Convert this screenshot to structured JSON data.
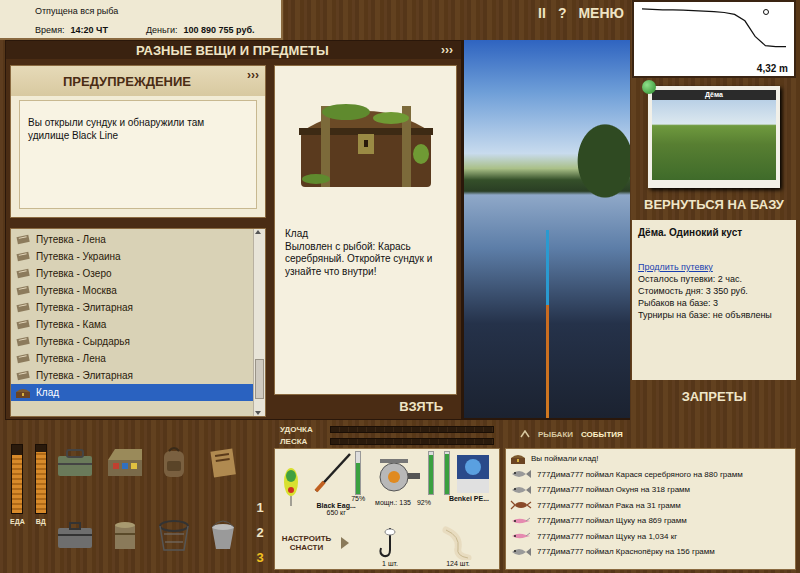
{
  "status": {
    "message": "Отпущена вся рыба",
    "time_label": "Время:",
    "time": "14:20 ЧТ",
    "money_label": "Деньги:",
    "money": "100 890 755 руб."
  },
  "top_controls": [
    "II",
    "?",
    "МЕНЮ"
  ],
  "depth_chart": {
    "depths": [
      0.2,
      0.25,
      0.3,
      0.3,
      0.35,
      0.4,
      0.45,
      0.5,
      0.6,
      0.8,
      1.5,
      3.2,
      4.2,
      4.32,
      4.32
    ],
    "reading": "4,32 m"
  },
  "window": {
    "title": "РАЗНЫЕ ВЕЩИ И ПРЕДМЕТЫ",
    "arrows": "›››"
  },
  "warning": {
    "title": "ПРЕДУПРЕЖДЕНИЕ",
    "arrows": "›››",
    "text": "Вы открыли сундук и обнаружили там удилище Black Line"
  },
  "items": [
    {
      "label": "Путевка - Лена",
      "selected": false,
      "kind": "permit"
    },
    {
      "label": "Путевка - Украина",
      "selected": false,
      "kind": "permit"
    },
    {
      "label": "Путевка - Озеро",
      "selected": false,
      "kind": "permit"
    },
    {
      "label": "Путевка - Москва",
      "selected": false,
      "kind": "permit"
    },
    {
      "label": "Путевка - Элитарная",
      "selected": false,
      "kind": "permit"
    },
    {
      "label": "Путевка - Кама",
      "selected": false,
      "kind": "permit"
    },
    {
      "label": "Путевка - Сырдарья",
      "selected": false,
      "kind": "permit"
    },
    {
      "label": "Путевка - Лена",
      "selected": false,
      "kind": "permit"
    },
    {
      "label": "Путевка - Элитарная",
      "selected": false,
      "kind": "permit"
    },
    {
      "label": "Клад",
      "selected": true,
      "kind": "treasure"
    }
  ],
  "list_scroll": {
    "level": 0.92
  },
  "detail": {
    "name": "Клад",
    "description": "Выловлен с рыбой: Карась серебряный. Откройте сундук и узнайте что внутри!"
  },
  "take_button": "ВЗЯТЬ",
  "location": {
    "card_label": "Дёма",
    "return_button": "ВЕРНУТЬСЯ НА БАЗУ",
    "name": "Дёма. Одинокий куст",
    "extend_link": "Продлить путевку",
    "details": [
      "Осталось путевки: 2 час.",
      "Стоимость дня: 3 350 руб.",
      "Рыбаков на базе: 3",
      "Турниры на базе: не объявлены"
    ],
    "bans_button": "ЗАПРЕТЫ"
  },
  "needs": [
    {
      "label": "ЕДА",
      "level": 0.85
    },
    {
      "label": "ВД",
      "level": 0.9
    }
  ],
  "tackle_sets": [
    {
      "label": "1",
      "selected": false
    },
    {
      "label": "2",
      "selected": false
    },
    {
      "label": "3",
      "selected": true
    }
  ],
  "tension": [
    {
      "label": "УДОЧКА",
      "level": 0
    },
    {
      "label": "ЛЕСКА",
      "level": 0
    }
  ],
  "event_tabs": [
    {
      "label": "РЫБАКИ",
      "selected": false
    },
    {
      "label": "СОБЫТИЯ",
      "selected": true
    }
  ],
  "tackle": {
    "rod": {
      "name": "Black Eag...",
      "load": "650 кг",
      "level": 0.75,
      "reading": "75%"
    },
    "reel": {
      "power": "мощн.: 135",
      "level": 0.92,
      "reading": "92%"
    },
    "line": {
      "name": "Benkei PE...",
      "level": 0.95
    },
    "hook": {
      "count": "1 шт."
    },
    "bait": {
      "count": "124 шт."
    },
    "setup_button": "НАСТРОИТЬ СНАСТИ"
  },
  "events": [
    {
      "text": "Вы поймали клад!",
      "kind": "treasure"
    },
    {
      "text": "777Дима777 поймал Карася серебряного на 880 грамм",
      "kind": "fish"
    },
    {
      "text": "777Дима777 поймал Окуня на 318 грамм",
      "kind": "fish"
    },
    {
      "text": "777Дима777 поймал Рака на 31 грамм",
      "kind": "crayfish"
    },
    {
      "text": "777Дима777 поймал Щуку на 869 грамм",
      "kind": "lure"
    },
    {
      "text": "777Дима777 поймал Щуку на 1,034 кг",
      "kind": "lure"
    },
    {
      "text": "777Дима777 поймал Краснопёрку на 156 грамм",
      "kind": "fish"
    }
  ]
}
